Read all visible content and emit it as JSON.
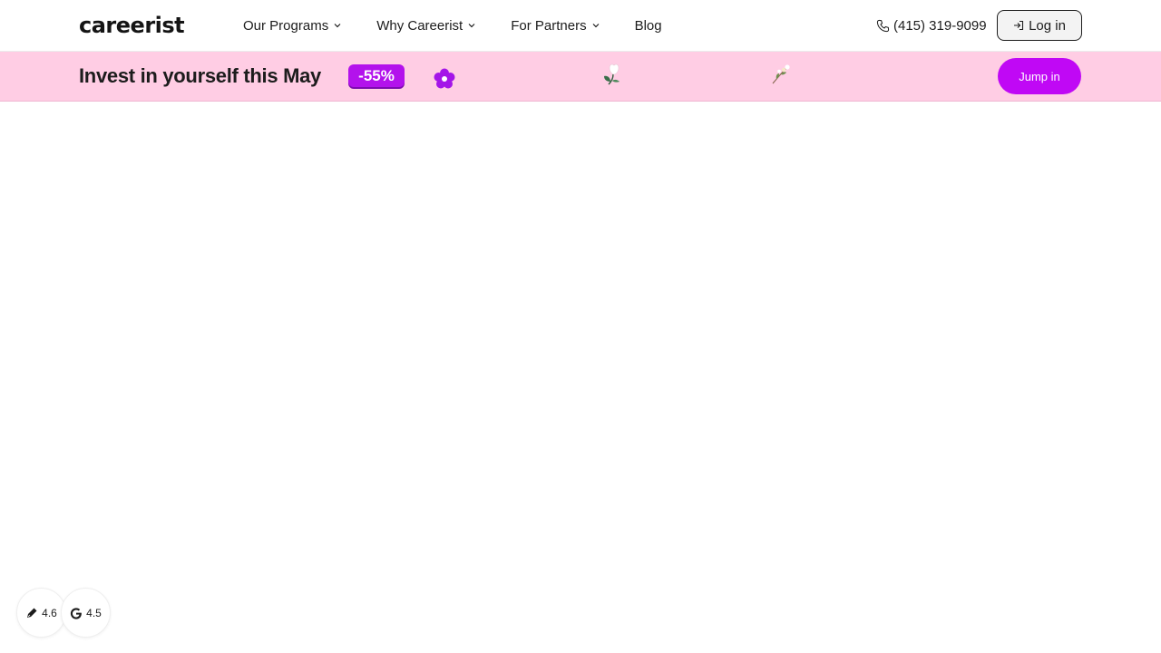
{
  "header": {
    "logo": "careerist",
    "nav": [
      {
        "label": "Our Programs",
        "has_dropdown": true
      },
      {
        "label": "Why Careerist",
        "has_dropdown": true
      },
      {
        "label": "For Partners",
        "has_dropdown": true
      },
      {
        "label": "Blog",
        "has_dropdown": false
      }
    ],
    "phone": "(415) 319-9099",
    "login_label": "Log in"
  },
  "promo": {
    "title": "Invest in yourself this May",
    "badge": "-55%",
    "cta": "Jump in",
    "background": "#ffcde4",
    "accent": "#c008f5"
  },
  "ratings": [
    {
      "icon": "pen-nib-icon",
      "value": "4.6"
    },
    {
      "icon": "google-icon",
      "value": "4.5"
    }
  ]
}
